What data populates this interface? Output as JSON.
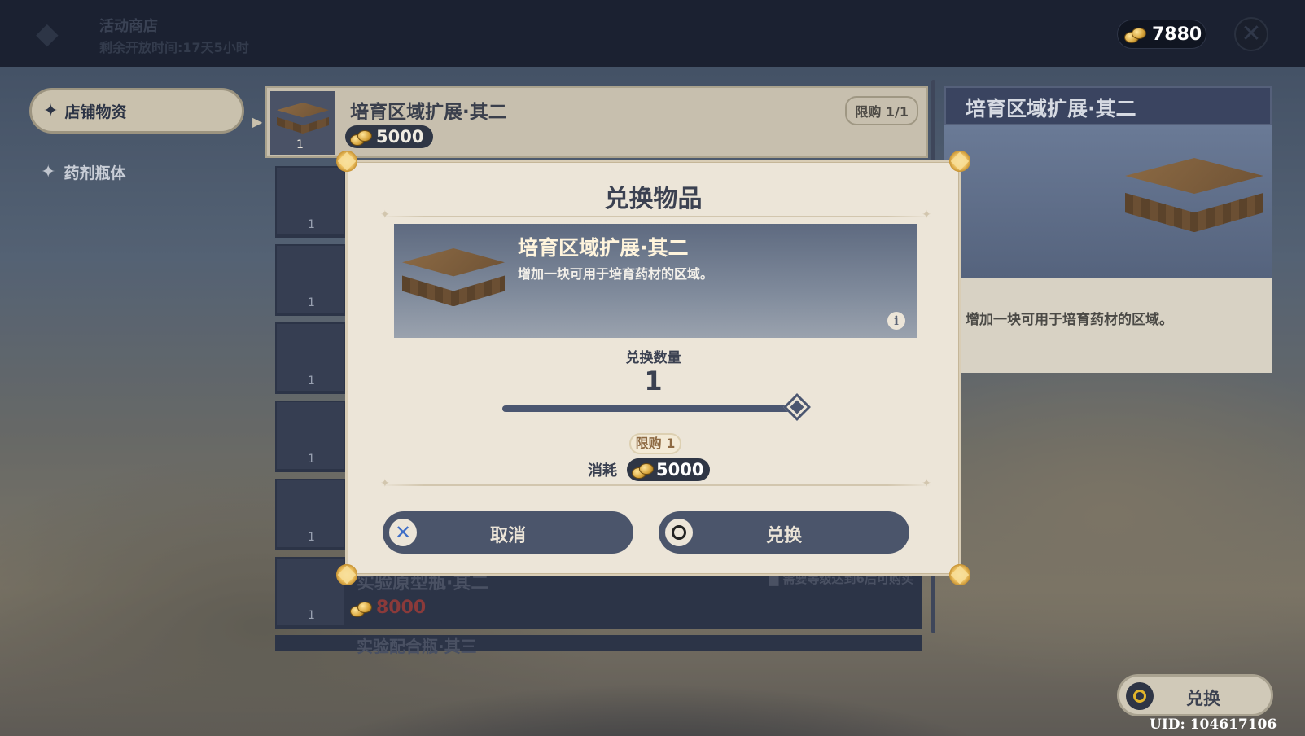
{
  "shop": {
    "title": "活动商店",
    "subtitle": "剩余开放时间:17天5小时"
  },
  "currency": {
    "icon": "mora-coin-icon",
    "value": "7880"
  },
  "tabs": [
    {
      "label": "店铺物资",
      "active": true
    },
    {
      "label": "药剂瓶体",
      "active": false
    }
  ],
  "list": {
    "items": [
      {
        "name": "培育区域扩展·其二",
        "price": "5000",
        "limit": "限购 1/1",
        "qty": "1"
      },
      {
        "qty": "1"
      },
      {
        "qty": "1"
      },
      {
        "qty": "1"
      },
      {
        "qty": "1"
      },
      {
        "qty": "1"
      },
      {
        "name": "实验原型瓶·其二",
        "price": "8000",
        "limit": "▇ 需要等级达到6后可购买",
        "qty": "1"
      },
      {
        "name": "实验配合瓶·其三",
        "limit": "",
        "qty": ""
      }
    ]
  },
  "detail": {
    "title": "培育区域扩展·其二",
    "description": "增加一块可用于培育药材的区域。"
  },
  "modal": {
    "title": "兑换物品",
    "item_name": "培育区域扩展·其二",
    "item_desc": "增加一块可用于培育药材的区域。",
    "info_glyph": "i",
    "qty_label": "兑换数量",
    "qty_value": "1",
    "slider_fraction": 1.0,
    "limit_label": "限购 1",
    "cost_label": "消耗",
    "cost_value": "5000",
    "cancel_label": "取消",
    "confirm_label": "兑换"
  },
  "footer": {
    "exchange_label": "兑换",
    "uid": "UID: 104617106"
  },
  "colors": {
    "accent_navy": "#4b556b",
    "modal_bg": "#ece5d8",
    "gold": "#e2b52b",
    "cancel_x": "#3f6ec7"
  }
}
